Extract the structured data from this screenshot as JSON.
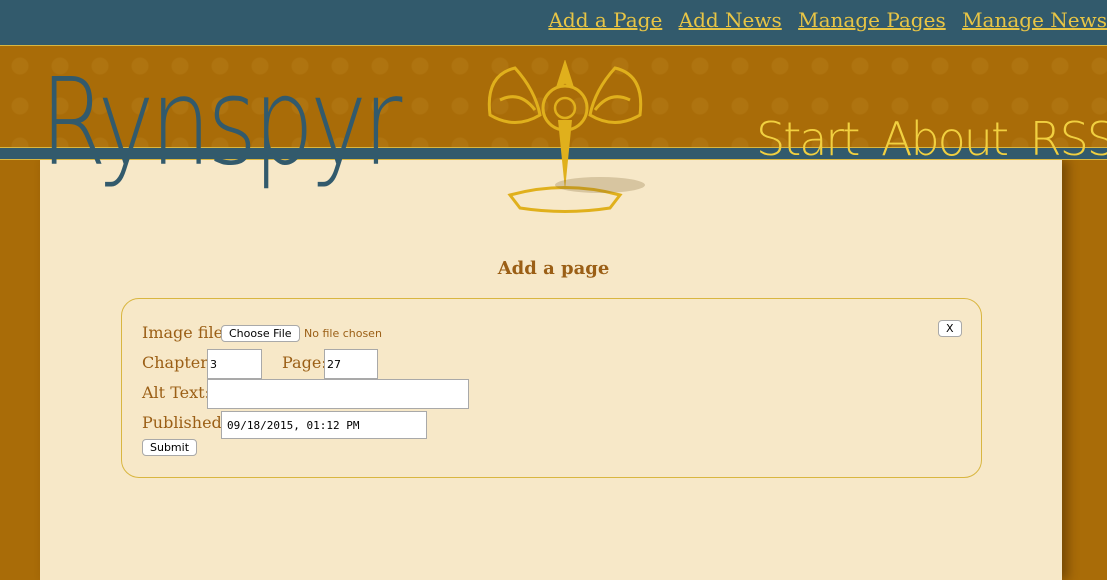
{
  "admin_nav": {
    "items": [
      "Add a Page",
      "Add News",
      "Manage Pages",
      "Manage News"
    ]
  },
  "header": {
    "brand": "Rynspyr",
    "main_nav": [
      "Start",
      "About",
      "RSS"
    ]
  },
  "form": {
    "title": "Add a page",
    "close_label": "X",
    "image_file_label": "Image file:",
    "choose_file_label": "Choose File",
    "no_file_text": "No file chosen",
    "chapter_label": "Chapter:",
    "chapter_value": "3",
    "page_label": "Page:",
    "page_value": "27",
    "alt_text_label": "Alt Text:",
    "alt_text_value": "",
    "published_label": "Published:",
    "published_value": "09/18/2015, 01:12 PM",
    "submit_label": "Submit"
  },
  "colors": {
    "topbar": "#325a6c",
    "header": "#a96c08",
    "panel": "#f7e8c8",
    "accent_gold": "#e8c545",
    "label_brown": "#9b5f16"
  }
}
